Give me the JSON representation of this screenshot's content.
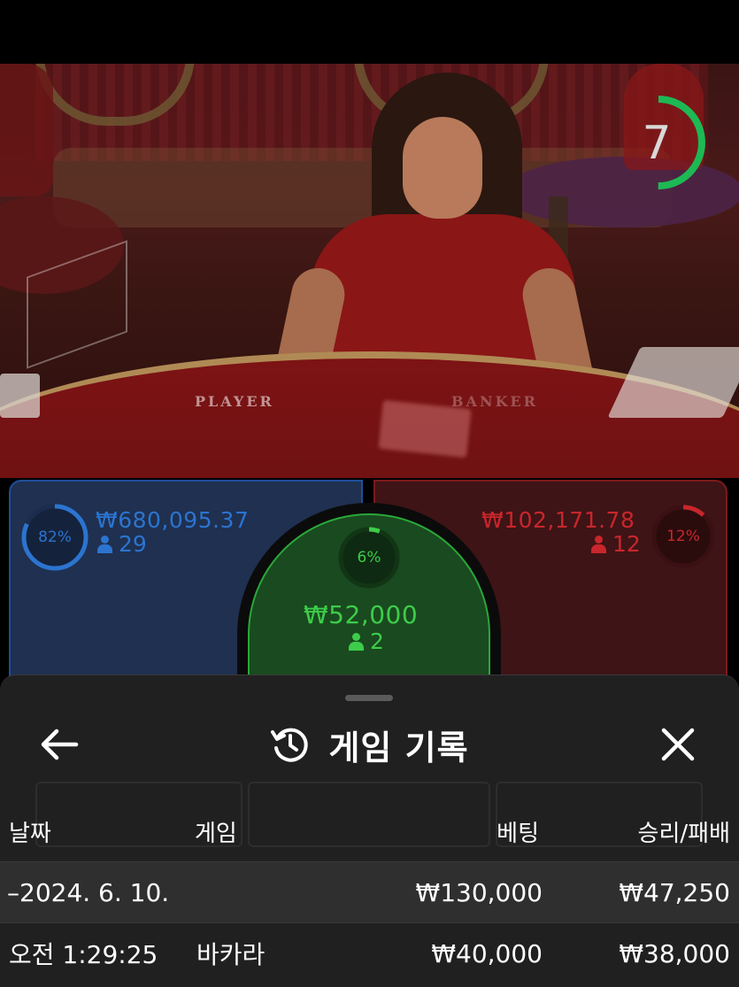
{
  "timer": {
    "value": "7",
    "progress": 0.5,
    "color": "#1db954"
  },
  "table_labels": {
    "player": "PLAYER",
    "banker": "BANKER"
  },
  "player": {
    "percent_label": "82%",
    "percent": 82,
    "amount": "₩680,095.37",
    "count": "29",
    "color": "#2b74d0"
  },
  "tie": {
    "percent_label": "6%",
    "percent": 6,
    "amount": "₩52,000",
    "count": "2",
    "color": "#3dcc4a"
  },
  "banker": {
    "percent_label": "12%",
    "percent": 12,
    "amount": "₩102,171.78",
    "count": "12",
    "color": "#c8262b"
  },
  "history": {
    "title": "게임 기록",
    "icons": {
      "back": "arrow-left-icon",
      "history": "history-icon",
      "close": "close-icon"
    },
    "columns": {
      "date": "날짜",
      "game": "게임",
      "bet": "베팅",
      "result": "승리/패배"
    },
    "date_row": {
      "date": "–2024. 6. 10.",
      "bet": "₩130,000",
      "result": "₩47,250"
    },
    "rows": [
      {
        "time": "오전 1:29:25",
        "game": "바카라",
        "bet": "₩40,000",
        "result": "₩38,000"
      }
    ]
  }
}
